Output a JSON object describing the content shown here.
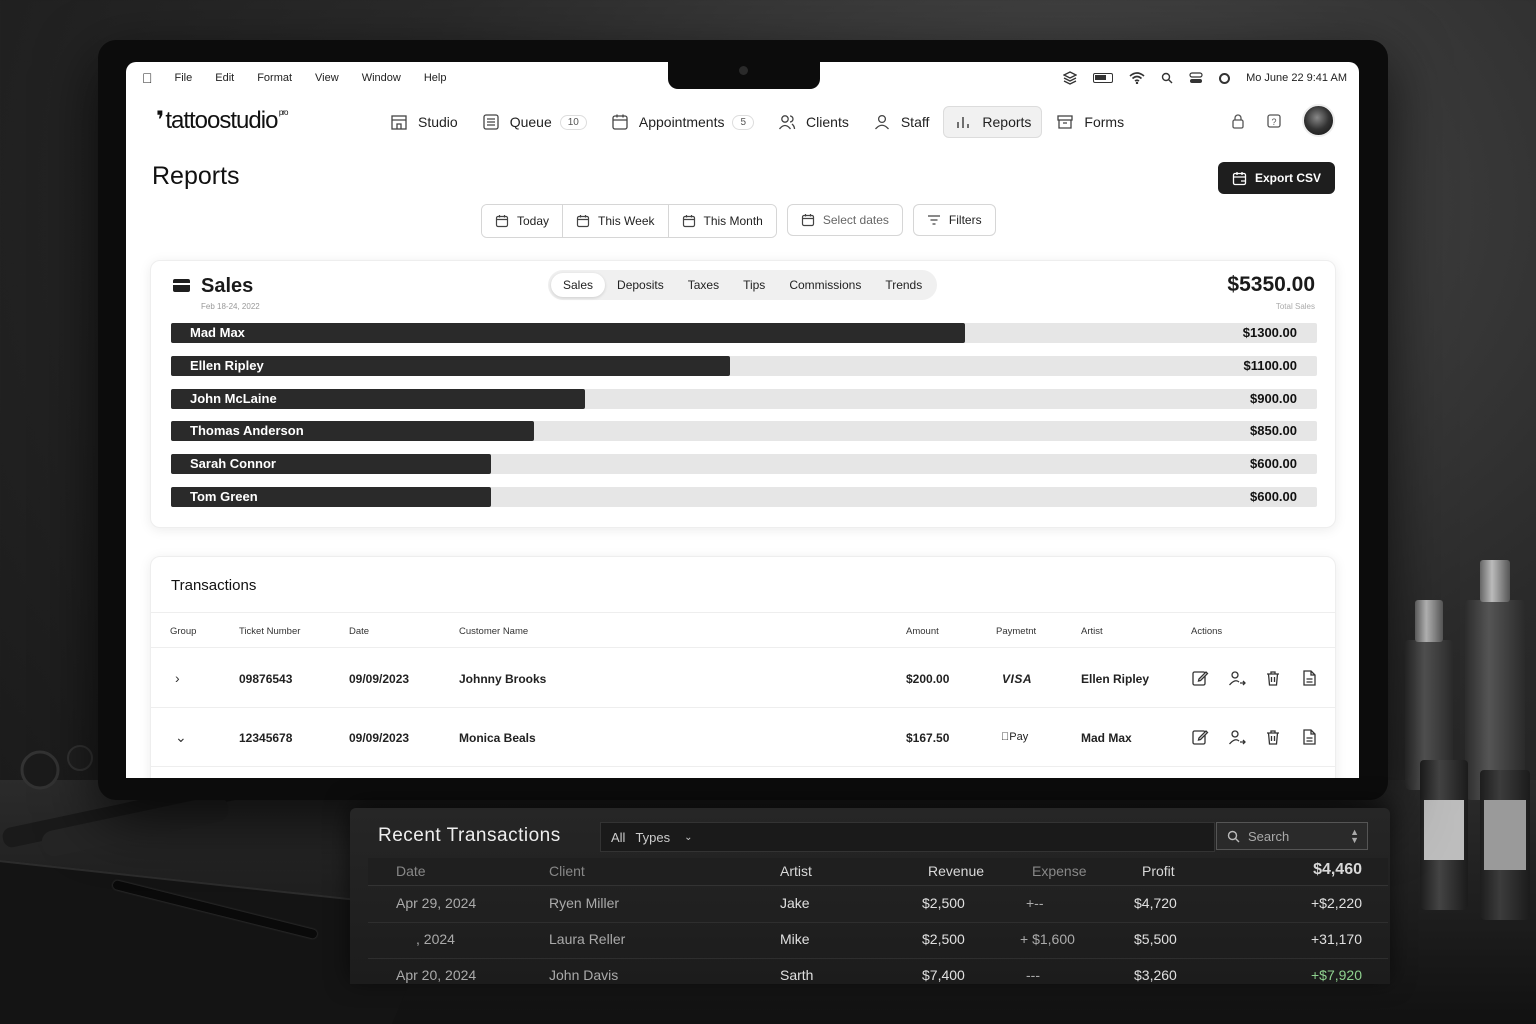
{
  "menubar": {
    "items": [
      "File",
      "Edit",
      "Format",
      "View",
      "Window",
      "Help"
    ],
    "datetime": "Mo June 22  9:41 AM"
  },
  "app": {
    "logo": "tattoostudio",
    "logo_sup": "pro"
  },
  "nav": [
    {
      "label": "Studio",
      "icon": "store-icon"
    },
    {
      "label": "Queue",
      "badge": "10",
      "icon": "list-icon"
    },
    {
      "label": "Appointments",
      "badge": "5",
      "icon": "calendar-icon"
    },
    {
      "label": "Clients",
      "icon": "users-icon"
    },
    {
      "label": "Staff",
      "icon": "staff-icon"
    },
    {
      "label": "Reports",
      "icon": "bar-chart-icon",
      "active": true
    },
    {
      "label": "Forms",
      "icon": "archive-icon"
    }
  ],
  "page": {
    "title": "Reports",
    "export_label": "Export CSV"
  },
  "datebar": {
    "segments": [
      "Today",
      "This Week",
      "This Month"
    ],
    "select_dates": "Select dates",
    "filters": "Filters"
  },
  "sales": {
    "title": "Sales",
    "subtitle": "Feb 18-24, 2022",
    "tabs": [
      "Sales",
      "Deposits",
      "Taxes",
      "Tips",
      "Commissions",
      "Trends"
    ],
    "active_tab": "Sales",
    "total": "$5350.00",
    "total_label": "Total Sales",
    "bars": [
      {
        "name": "Mad Max",
        "value": "$1300.00",
        "fill": 0.693
      },
      {
        "name": "Ellen Ripley",
        "value": "$1100.00",
        "fill": 0.488
      },
      {
        "name": "John McLaine",
        "value": "$900.00",
        "fill": 0.361
      },
      {
        "name": "Thomas Anderson",
        "value": "$850.00",
        "fill": 0.317
      },
      {
        "name": "Sarah Connor",
        "value": "$600.00",
        "fill": 0.279
      },
      {
        "name": "Tom Green",
        "value": "$600.00",
        "fill": 0.279
      }
    ]
  },
  "transactions": {
    "title": "Transactions",
    "headers": [
      "Group",
      "Ticket Number",
      "Date",
      "Customer Name",
      "Amount",
      "Paymetnt",
      "Artist",
      "Actions"
    ],
    "rows": [
      {
        "chevron": "›",
        "ticket": "09876543",
        "date": "09/09/2023",
        "customer": "Johnny Brooks",
        "amount": "$200.00",
        "payment": "VISA",
        "artist": "Ellen Ripley"
      },
      {
        "chevron": "⌄",
        "ticket": "12345678",
        "date": "09/09/2023",
        "customer": "Monica Beals",
        "amount": "$167.50",
        "payment": "Pay",
        "artist": "Mad Max"
      }
    ]
  },
  "recent": {
    "title": "Recent Transactions",
    "filter_all": "All",
    "filter_types": "Types",
    "search_placeholder": "Search",
    "headers": [
      "Date",
      "Client",
      "Artist",
      "Revenue",
      "Expense",
      "Profit",
      "$4,460"
    ],
    "rows": [
      {
        "date": "Apr 29, 2024",
        "client": "Ryen Miller",
        "artist": "Jake",
        "revenue": "$2,500",
        "expense": "+--",
        "profit": "$4,720",
        "net": "+$2,220"
      },
      {
        "date": ", 2024",
        "client": "Laura Reller",
        "artist": "Mike",
        "revenue": "$2,500",
        "expense": "+ $1,600",
        "profit": "$5,500",
        "net": "+31,170"
      },
      {
        "date": "Apr 20, 2024",
        "client": "John Davis",
        "artist": "Sarth",
        "revenue": "$7,400",
        "expense": "---",
        "profit": "$3,260",
        "net": "+$7,920"
      }
    ]
  },
  "colors": {
    "accent": "#1e1e1e",
    "bar_fill": "#2a2a2a",
    "bar_track": "#e6e6e6",
    "positive": "#8fd18f"
  }
}
